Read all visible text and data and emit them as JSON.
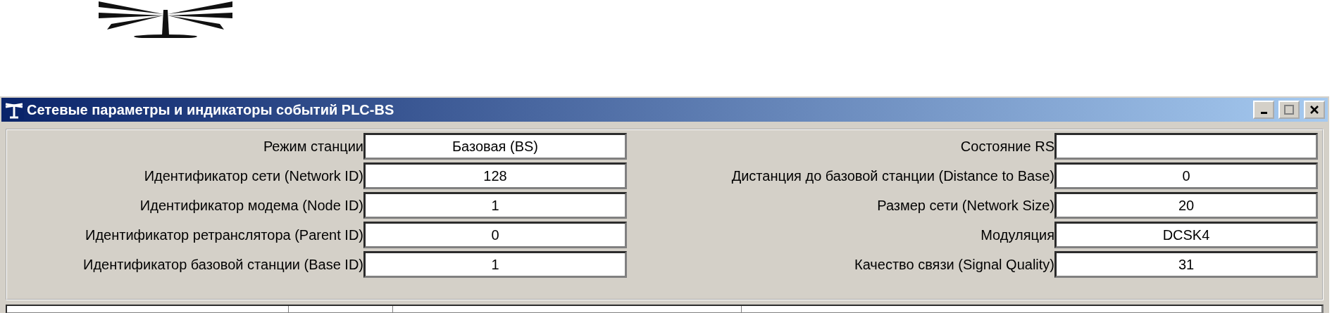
{
  "window": {
    "title": "Сетевые параметры и индикаторы событий PLC-BS"
  },
  "left_fields": [
    {
      "label": "Режим станции",
      "value": "Базовая (BS)"
    },
    {
      "label": "Идентификатор сети (Network ID)",
      "value": "128"
    },
    {
      "label": "Идентификатор модема (Node ID)",
      "value": "1"
    },
    {
      "label": "Идентификатор ретранслятора (Parent ID)",
      "value": "0"
    },
    {
      "label": "Идентификатор базовой станции (Base ID)",
      "value": "1"
    }
  ],
  "right_fields": [
    {
      "label": "Состояние RS"
    },
    {
      "label": "Дистанция до базовой станции (Distance to Base)",
      "value": "0"
    },
    {
      "label": "Размер сети (Network Size)",
      "value": "20"
    },
    {
      "label": "Модуляция",
      "value": "DCSK4"
    },
    {
      "label": "Качество связи (Signal Quality)",
      "value": "31"
    }
  ]
}
